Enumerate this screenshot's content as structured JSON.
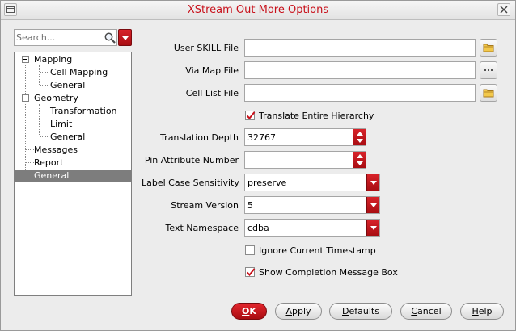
{
  "window": {
    "title": "XStream Out More Options"
  },
  "search": {
    "placeholder": "Search..."
  },
  "tree": [
    {
      "label": "Mapping",
      "level": 0,
      "expandable": true
    },
    {
      "label": "Cell Mapping",
      "level": 1
    },
    {
      "label": "General",
      "level": 1
    },
    {
      "label": "Geometry",
      "level": 0,
      "expandable": true
    },
    {
      "label": "Transformation",
      "level": 1
    },
    {
      "label": "Limit",
      "level": 1
    },
    {
      "label": "General",
      "level": 1
    },
    {
      "label": "Messages",
      "level": 0
    },
    {
      "label": "Report",
      "level": 0
    },
    {
      "label": "General",
      "level": 0,
      "selected": true
    }
  ],
  "form": {
    "user_skill_file": {
      "label": "User SKILL File",
      "value": ""
    },
    "via_map_file": {
      "label": "Via Map File",
      "value": ""
    },
    "cell_list_file": {
      "label": "Cell List File",
      "value": ""
    },
    "translate_hierarchy": {
      "label": "Translate Entire Hierarchy",
      "checked": true
    },
    "translation_depth": {
      "label": "Translation Depth",
      "value": "32767"
    },
    "pin_attribute_number": {
      "label": "Pin Attribute Number",
      "value": ""
    },
    "label_case_sensitivity": {
      "label": "Label Case Sensitivity",
      "value": "preserve"
    },
    "stream_version": {
      "label": "Stream Version",
      "value": "5"
    },
    "text_namespace": {
      "label": "Text Namespace",
      "value": "cdba"
    },
    "ignore_timestamp": {
      "label": "Ignore Current Timestamp",
      "checked": false
    },
    "show_completion": {
      "label": "Show Completion Message Box",
      "checked": true
    }
  },
  "buttons": {
    "ok": {
      "mnemonic": "O",
      "rest": "K"
    },
    "apply": {
      "mnemonic": "A",
      "rest": "pply"
    },
    "defaults": {
      "mnemonic": "D",
      "rest": "efaults"
    },
    "cancel": {
      "mnemonic": "C",
      "rest": "ancel"
    },
    "help": {
      "mnemonic": "H",
      "rest": "elp"
    }
  },
  "colors": {
    "accent_red": "#c8101a",
    "selection_gray": "#7d7d7d"
  }
}
